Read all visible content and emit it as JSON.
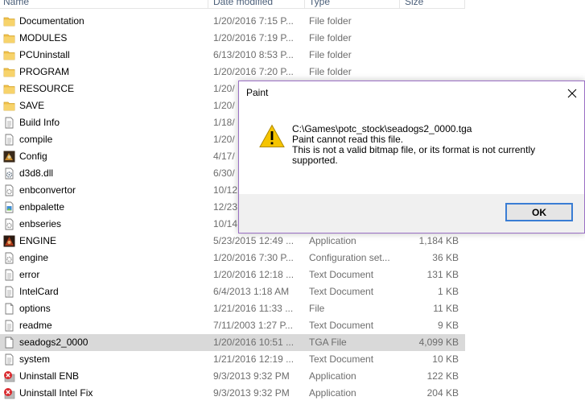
{
  "columns": {
    "name": "Name",
    "date": "Date modified",
    "type": "Type",
    "size": "Size"
  },
  "files": [
    {
      "name": "Documentation",
      "date": "1/20/2016 7:15 P...",
      "type": "File folder",
      "size": "",
      "icon": "folder-icon"
    },
    {
      "name": "MODULES",
      "date": "1/20/2016 7:19 P...",
      "type": "File folder",
      "size": "",
      "icon": "folder-icon"
    },
    {
      "name": "PCUninstall",
      "date": "6/13/2010 8:53 P...",
      "type": "File folder",
      "size": "",
      "icon": "folder-icon"
    },
    {
      "name": "PROGRAM",
      "date": "1/20/2016 7:20 P...",
      "type": "File folder",
      "size": "",
      "icon": "folder-icon"
    },
    {
      "name": "RESOURCE",
      "date": "1/20/",
      "type": "",
      "size": "",
      "icon": "folder-icon"
    },
    {
      "name": "SAVE",
      "date": "1/20/",
      "type": "",
      "size": "",
      "icon": "folder-icon"
    },
    {
      "name": "Build Info",
      "date": "1/18/",
      "type": "",
      "size": "",
      "icon": "document-icon"
    },
    {
      "name": "compile",
      "date": "1/20/",
      "type": "",
      "size": "",
      "icon": "document-icon"
    },
    {
      "name": "Config",
      "date": "4/17/",
      "type": "",
      "size": "",
      "icon": "app-config-icon"
    },
    {
      "name": "d3d8.dll",
      "date": "6/30/",
      "type": "",
      "size": "",
      "icon": "dll-gear-icon"
    },
    {
      "name": "enbconvertor",
      "date": "10/12",
      "type": "",
      "size": "",
      "icon": "settings-file-icon"
    },
    {
      "name": "enbpalette",
      "date": "12/23",
      "type": "",
      "size": "",
      "icon": "image-file-icon"
    },
    {
      "name": "enbseries",
      "date": "10/14",
      "type": "",
      "size": "",
      "icon": "settings-file-icon"
    },
    {
      "name": "ENGINE",
      "date": "5/23/2015 12:49 ...",
      "type": "Application",
      "size": "1,184 KB",
      "icon": "app-engine-icon"
    },
    {
      "name": "engine",
      "date": "1/20/2016 7:30 P...",
      "type": "Configuration set...",
      "size": "36 KB",
      "icon": "settings-file-icon"
    },
    {
      "name": "error",
      "date": "1/20/2016 12:18 ...",
      "type": "Text Document",
      "size": "131 KB",
      "icon": "document-icon"
    },
    {
      "name": "IntelCard",
      "date": "6/4/2013 1:18 AM",
      "type": "Text Document",
      "size": "1 KB",
      "icon": "document-icon"
    },
    {
      "name": "options",
      "date": "1/21/2016 11:33 ...",
      "type": "File",
      "size": "11 KB",
      "icon": "blank-file-icon"
    },
    {
      "name": "readme",
      "date": "7/11/2003 1:27 P...",
      "type": "Text Document",
      "size": "9 KB",
      "icon": "document-icon"
    },
    {
      "name": "seadogs2_0000",
      "date": "1/20/2016 10:51 ...",
      "type": "TGA File",
      "size": "4,099 KB",
      "icon": "tga-file-icon",
      "selected": true
    },
    {
      "name": "system",
      "date": "1/21/2016 12:19 ...",
      "type": "Text Document",
      "size": "10 KB",
      "icon": "document-icon"
    },
    {
      "name": "Uninstall ENB",
      "date": "9/3/2013 9:32 PM",
      "type": "Application",
      "size": "122 KB",
      "icon": "uninstall-icon"
    },
    {
      "name": "Uninstall Intel Fix",
      "date": "9/3/2013 9:32 PM",
      "type": "Application",
      "size": "204 KB",
      "icon": "uninstall-icon"
    }
  ],
  "dialog": {
    "title": "Paint",
    "path": "C:\\Games\\potc_stock\\seadogs2_0000.tga",
    "line1": "Paint cannot read this file.",
    "line2": "This is not a valid bitmap file, or its format is not currently supported.",
    "ok_label": "OK"
  },
  "colors": {
    "dialog_border": "#9a6fc4",
    "ok_border": "#3a7dd4",
    "selected_row": "#d9d9d9",
    "warning": "#f5c400"
  }
}
